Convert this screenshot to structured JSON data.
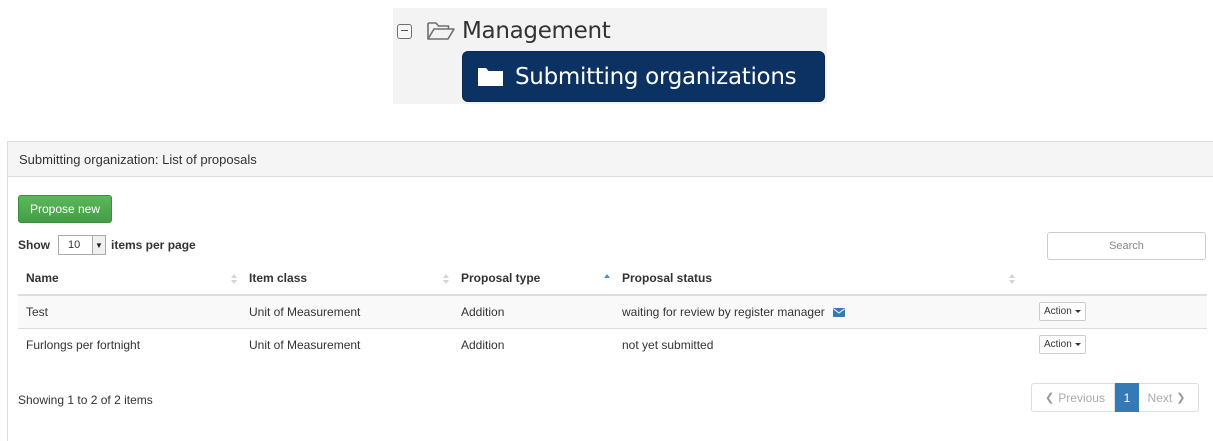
{
  "tree": {
    "parent_label": "Management",
    "child_label": "Submitting organizations"
  },
  "panel": {
    "heading": "Submitting organization: List of proposals",
    "propose_button": "Propose new",
    "length": {
      "prefix": "Show",
      "value": "10",
      "suffix": "items per page"
    },
    "search_placeholder": "Search"
  },
  "table": {
    "columns": [
      {
        "label": "Name"
      },
      {
        "label": "Item class"
      },
      {
        "label": "Proposal type"
      },
      {
        "label": "Proposal status"
      },
      {
        "label": ""
      }
    ],
    "rows": [
      {
        "name": "Test",
        "item_class": "Unit of Measurement",
        "proposal_type": "Addition",
        "status": "waiting for review by register manager",
        "action": "Action"
      },
      {
        "name": "Furlongs per fortnight",
        "item_class": "Unit of Measurement",
        "proposal_type": "Addition",
        "status": "not yet submitted",
        "action": "Action"
      }
    ]
  },
  "footer": {
    "info": "Showing 1 to 2 of 2 items",
    "previous": "Previous",
    "current_page": "1",
    "next": "Next"
  },
  "colors": {
    "tree_selected_bg": "#0b3262",
    "propose_green": "#5cb85c",
    "page_active": "#337ab7",
    "mail_icon": "#337ab7"
  },
  "icons": [
    "collapse-icon",
    "folder-open-icon",
    "folder-icon",
    "sort-icon",
    "sort-asc-icon",
    "envelope-icon",
    "caret-down-icon",
    "chevron-left-icon",
    "chevron-right-icon"
  ]
}
